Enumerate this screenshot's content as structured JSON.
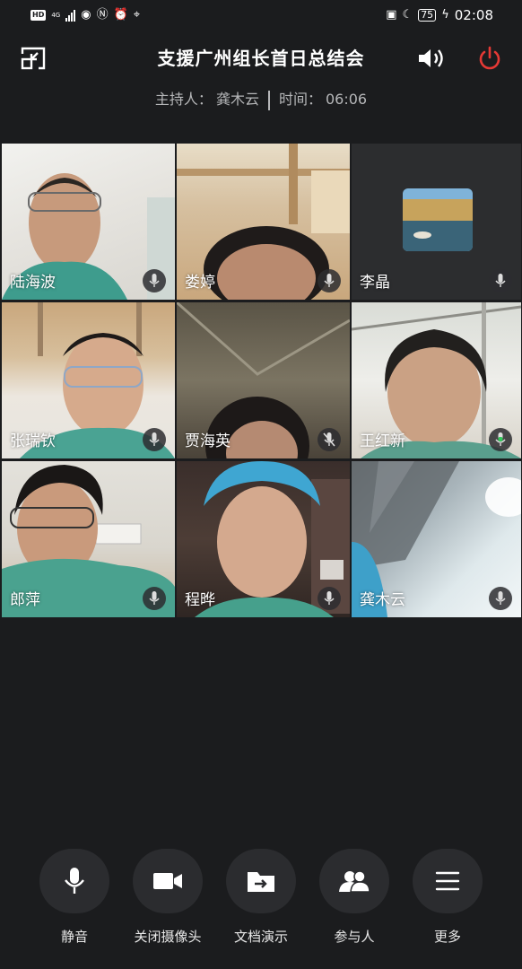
{
  "status_bar": {
    "left_icons": [
      "hd-icon",
      "network-4g-icon",
      "signal-icon",
      "eye-icon",
      "nfc-icon",
      "alarm-icon",
      "location-icon"
    ],
    "hd": "HD",
    "net": "4G",
    "battery": "75",
    "time": "02:08"
  },
  "header": {
    "title": "支援广州组长首日总结会",
    "host_label": "主持人：",
    "host_name": "龚木云",
    "time_label": "时间：",
    "elapsed": "06:06"
  },
  "participants": [
    {
      "name": "陆海波",
      "mic": "on"
    },
    {
      "name": "娄婷",
      "mic": "on"
    },
    {
      "name": "李晶",
      "mic": "on"
    },
    {
      "name": "张瑞钦",
      "mic": "on"
    },
    {
      "name": "贾海英",
      "mic": "muted"
    },
    {
      "name": "王红新",
      "mic": "speaking"
    },
    {
      "name": "郎萍",
      "mic": "on"
    },
    {
      "name": "程晔",
      "mic": "on"
    },
    {
      "name": "龚木云",
      "mic": "on"
    }
  ],
  "toolbar": {
    "mute": "静音",
    "camera": "关闭摄像头",
    "docs": "文档演示",
    "participants": "参与人",
    "more": "更多"
  },
  "colors": {
    "background": "#1b1c1e",
    "hangup": "#e53935",
    "speaking": "#32c85a",
    "scrub": "#2a2b2d"
  }
}
